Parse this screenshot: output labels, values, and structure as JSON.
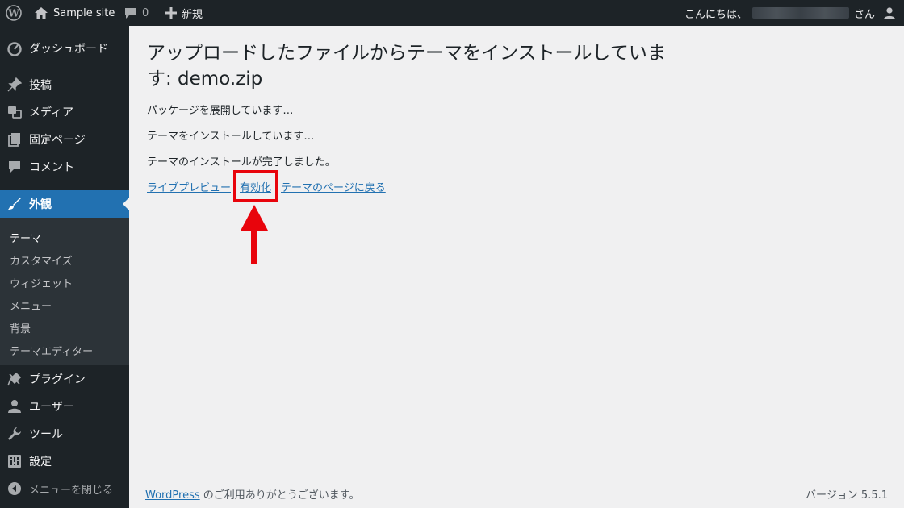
{
  "adminbar": {
    "site_name": "Sample site",
    "comments_count": "0",
    "new_label": "新規",
    "greeting": "こんにちは、",
    "greeting_suffix": "さん"
  },
  "sidebar": {
    "items": [
      {
        "label": "ダッシュボード",
        "icon": "dashboard-icon"
      },
      {
        "label": "投稿",
        "icon": "pin-icon"
      },
      {
        "label": "メディア",
        "icon": "media-icon"
      },
      {
        "label": "固定ページ",
        "icon": "pages-icon"
      },
      {
        "label": "コメント",
        "icon": "comment-icon"
      },
      {
        "label": "外観",
        "icon": "brush-icon",
        "current": true
      },
      {
        "label": "プラグイン",
        "icon": "plugin-icon"
      },
      {
        "label": "ユーザー",
        "icon": "user-icon"
      },
      {
        "label": "ツール",
        "icon": "wrench-icon"
      },
      {
        "label": "設定",
        "icon": "settings-icon"
      },
      {
        "label": "メニューを閉じる",
        "icon": "collapse-icon"
      }
    ],
    "submenu": [
      "テーマ",
      "カスタマイズ",
      "ウィジェット",
      "メニュー",
      "背景",
      "テーマエディター"
    ]
  },
  "main": {
    "title": "アップロードしたファイルからテーマをインストールしています: demo.zip",
    "messages": [
      "パッケージを展開しています…",
      "テーマをインストールしています…",
      "テーマのインストールが完了しました。"
    ],
    "links": {
      "live_preview": "ライブプレビュー",
      "activate": "有効化",
      "back": "テーマのページに戻る"
    }
  },
  "footer": {
    "wordpress_link": "WordPress",
    "thanks": " のご利用ありがとうございます。",
    "version": "バージョン 5.5.1"
  },
  "colors": {
    "admin_dark": "#1d2327",
    "accent": "#2271b1",
    "highlight": "#e8040c",
    "background": "#f0f0f1"
  }
}
